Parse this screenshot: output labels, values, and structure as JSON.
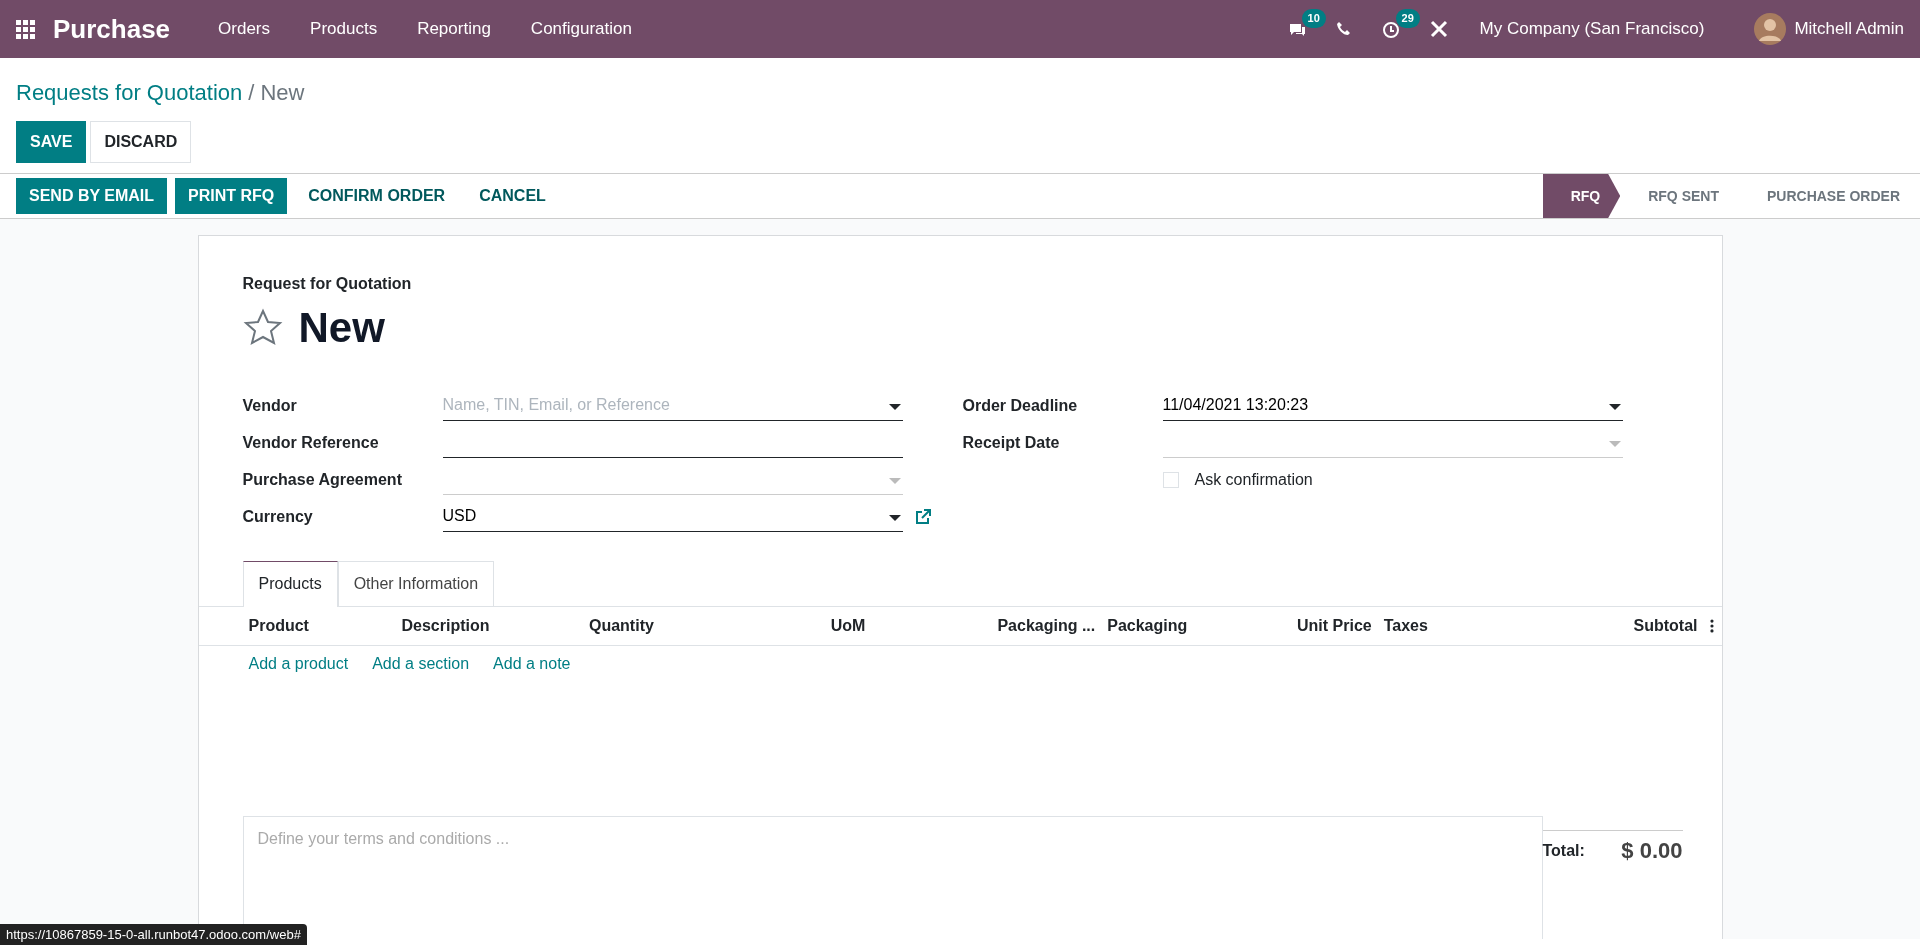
{
  "navbar": {
    "app_name": "Purchase",
    "menu": [
      "Orders",
      "Products",
      "Reporting",
      "Configuration"
    ],
    "messages_count": "10",
    "activities_count": "29",
    "company": "My Company (San Francisco)",
    "user": "Mitchell Admin"
  },
  "breadcrumb": {
    "parent": "Requests for Quotation",
    "separator": "/",
    "current": "New"
  },
  "edit_buttons": [
    {
      "label": "SAVE",
      "kind": "primary"
    },
    {
      "label": "DISCARD",
      "kind": "secondary"
    }
  ],
  "action_buttons": [
    {
      "label": "SEND BY EMAIL",
      "kind": "primary"
    },
    {
      "label": "PRINT RFQ",
      "kind": "primary"
    },
    {
      "label": "CONFIRM ORDER",
      "kind": "link"
    },
    {
      "label": "CANCEL",
      "kind": "link"
    }
  ],
  "stages": [
    {
      "label": "RFQ",
      "selected": true
    },
    {
      "label": "RFQ SENT",
      "selected": false
    },
    {
      "label": "PURCHASE ORDER",
      "selected": false
    }
  ],
  "form": {
    "subtitle": "Request for Quotation",
    "title": "New",
    "starred": false,
    "left_fields": [
      {
        "label": "Vendor",
        "placeholder": "Name, TIN, Email, or Reference",
        "kind": "select",
        "disabled": false
      },
      {
        "label": "Vendor Reference",
        "kind": "text",
        "disabled": false
      },
      {
        "label": "Purchase Agreement",
        "kind": "select",
        "disabled": true
      },
      {
        "label": "Currency",
        "value": "USD",
        "kind": "select",
        "disabled": false,
        "external_link": true
      }
    ],
    "right_fields": [
      {
        "label": "Order Deadline",
        "value": "11/04/2021 13:20:23",
        "kind": "select",
        "disabled": false
      },
      {
        "label": "Receipt Date",
        "kind": "select",
        "disabled": true
      },
      {
        "label": "Ask confirmation",
        "kind": "checkbox",
        "checked": false
      }
    ],
    "tabs": [
      {
        "label": "Products",
        "selected": true
      },
      {
        "label": "Other Information",
        "selected": false
      }
    ],
    "columns": [
      "Product",
      "Description",
      "Quantity",
      "UoM",
      "Packaging ...",
      "Packaging",
      "Unit Price",
      "Taxes",
      "Subtotal"
    ],
    "add_links": [
      "Add a product",
      "Add a section",
      "Add a note"
    ],
    "terms_placeholder": "Define your terms and conditions ...",
    "total_label": "Total:",
    "total_value": "$ 0.00"
  },
  "status_bar": "https://10867859-15-0-all.runbot47.odoo.com/web#"
}
